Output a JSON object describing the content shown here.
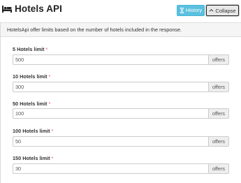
{
  "header": {
    "title": "Hotels API",
    "icon": "bed-icon",
    "history_label": "History",
    "collapse_label": "Collapse"
  },
  "panel": {
    "description": "HotelsApi offer limits based on the number of hotels included in the response."
  },
  "fields": [
    {
      "label": "5 Hotels limit",
      "value": "500",
      "addon": "offers"
    },
    {
      "label": "10 Hotels limit",
      "value": "300",
      "addon": "offers"
    },
    {
      "label": "50 Hotels limit",
      "value": "100",
      "addon": "offers"
    },
    {
      "label": "100 Hotels limit",
      "value": "50",
      "addon": "offers"
    },
    {
      "label": "150 Hotels limit",
      "value": "30",
      "addon": "offers"
    }
  ],
  "required_marker": "*",
  "colors": {
    "history_button": "#5bc0de",
    "required": "#d9534f"
  }
}
